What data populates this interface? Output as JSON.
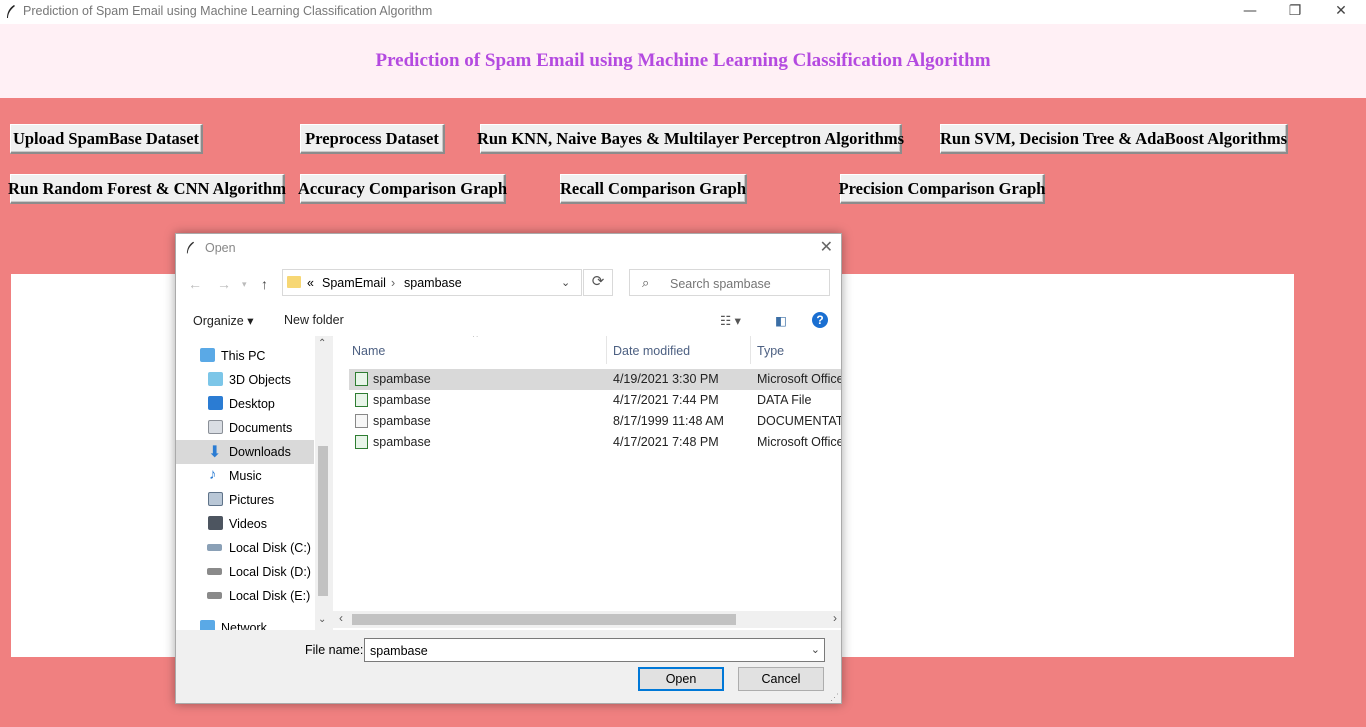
{
  "window": {
    "title": "Prediction of Spam Email using Machine Learning Classification Algorithm",
    "minimize": "—",
    "restore": "❐",
    "close": "✕"
  },
  "header": {
    "title": "Prediction of Spam Email using Machine Learning Classification Algorithm"
  },
  "buttons": {
    "upload": "Upload SpamBase Dataset",
    "preprocess": "Preprocess Dataset",
    "run_knn": "Run KNN, Naive Bayes & Multilayer Perceptron Algorithms",
    "run_svm": "Run SVM, Decision Tree & AdaBoost Algorithms",
    "run_rf": "Run Random Forest & CNN Algorithm",
    "accuracy": "Accuracy Comparison Graph",
    "recall": "Recall Comparison Graph",
    "precision": "Precision Comparison Graph"
  },
  "dialog": {
    "title": "Open",
    "close": "✕",
    "address": {
      "chevrons": "«",
      "parent": "SpamEmail",
      "sep": "›",
      "current": "spambase"
    },
    "search_placeholder": "Search spambase",
    "toolbar": {
      "organize": "Organize ▾",
      "new_folder": "New folder"
    },
    "nav_items": [
      {
        "label": "This PC"
      },
      {
        "label": "3D Objects"
      },
      {
        "label": "Desktop"
      },
      {
        "label": "Documents"
      },
      {
        "label": "Downloads"
      },
      {
        "label": "Music"
      },
      {
        "label": "Pictures"
      },
      {
        "label": "Videos"
      },
      {
        "label": "Local Disk (C:)"
      },
      {
        "label": "Local Disk (D:)"
      },
      {
        "label": "Local Disk (E:)"
      },
      {
        "label": "Network"
      }
    ],
    "columns": {
      "name": "Name",
      "date": "Date modified",
      "type": "Type"
    },
    "files": [
      {
        "name": "spambase",
        "date": "4/19/2021 3:30 PM",
        "type": "Microsoft Office"
      },
      {
        "name": "spambase",
        "date": "4/17/2021 7:44 PM",
        "type": "DATA File"
      },
      {
        "name": "spambase",
        "date": "8/17/1999 11:48 AM",
        "type": "DOCUMENTATIO"
      },
      {
        "name": "spambase",
        "date": "4/17/2021 7:48 PM",
        "type": "Microsoft Office"
      }
    ],
    "file_name_label": "File name:",
    "file_name_value": "spambase",
    "open_button": "Open",
    "cancel_button": "Cancel"
  },
  "colors": {
    "background": "#f08080",
    "header_bg": "#fff0f5",
    "heading": "#b44ae0"
  }
}
